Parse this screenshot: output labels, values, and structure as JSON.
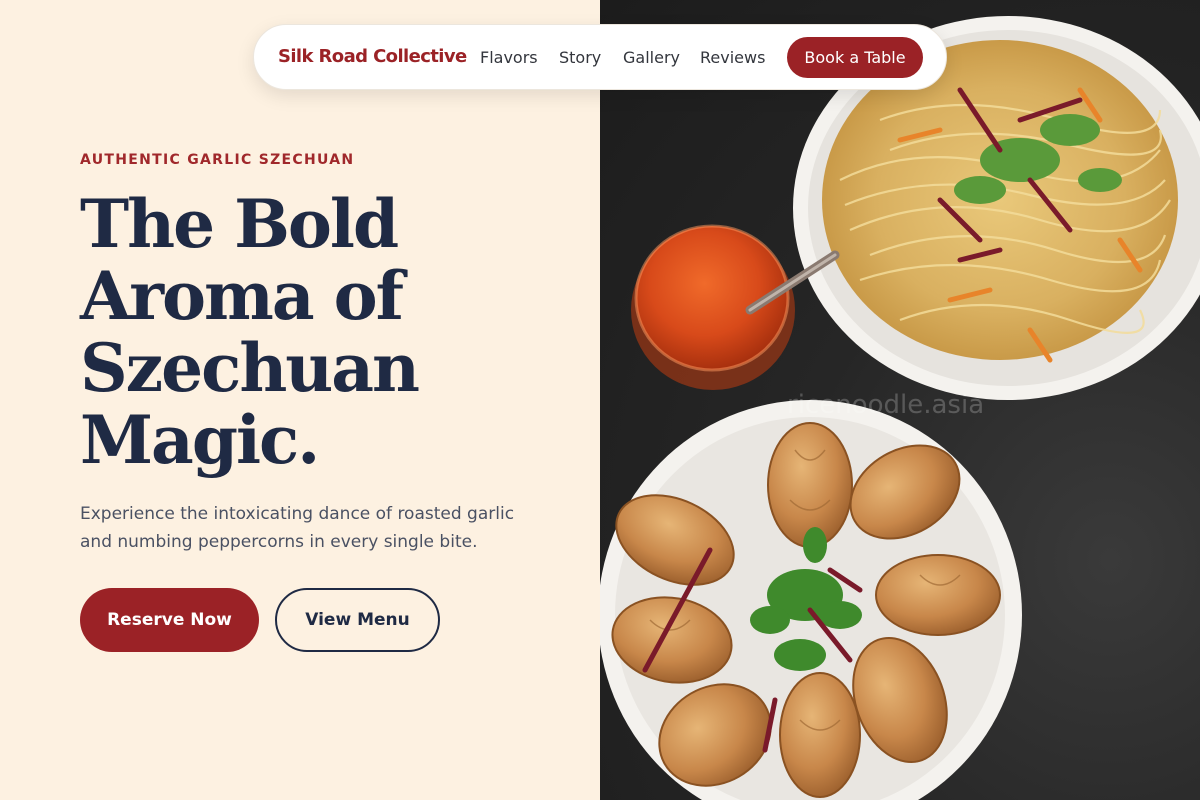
{
  "nav": {
    "brand": "Silk Road Collective",
    "links": [
      "Flavors",
      "Story",
      "Gallery",
      "Reviews"
    ],
    "cta": "Book a Table"
  },
  "hero": {
    "eyebrow": "AUTHENTIC GARLIC SZECHUAN",
    "headline_lines": [
      "The Bold",
      "Aroma of",
      "Szechuan",
      "Magic."
    ],
    "subtitle": "Experience the intoxicating dance of roasted garlic and numbing peppercorns in every single bite.",
    "primary_button": "Reserve Now",
    "secondary_button": "View Menu"
  },
  "image": {
    "watermark": "ricenoodle.asia",
    "content": [
      "noodles-plate",
      "chili-sauce-jar",
      "momo-plate"
    ]
  },
  "colors": {
    "accent": "#9b2226",
    "heading": "#1f2a44",
    "background": "#fdf1e1"
  }
}
